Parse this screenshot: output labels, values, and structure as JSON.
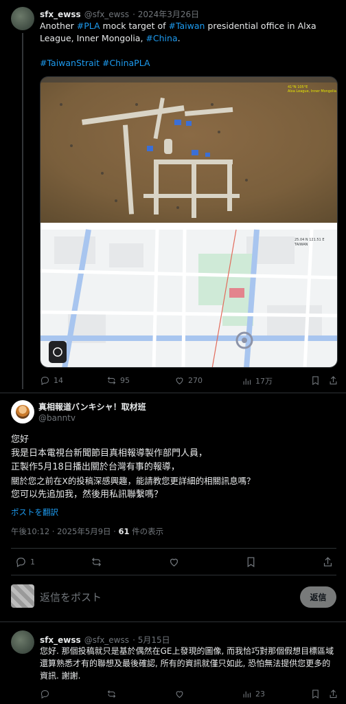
{
  "tweet1": {
    "name": "sfx_ewss",
    "handle": "@sfx_ewss",
    "date": "· 2024年3月26日",
    "text_parts": [
      "Another ",
      "#PLA",
      " mock target of ",
      "#Taiwan",
      " presidential office in Alxa League, Inner Mongolia, ",
      "#China",
      "."
    ],
    "hashtags_line": [
      "#TaiwanStrait",
      "#ChinaPLA"
    ],
    "map_label": "TAIWAN",
    "actions": {
      "replies": "14",
      "reposts": "95",
      "likes": "270",
      "views": "17万"
    }
  },
  "tweet2": {
    "name": "真相報道バンキシャ！取材班",
    "handle": "@banntv",
    "lines": [
      "您好",
      "我是日本電視台新聞節目真相報導製作部門人員，",
      "正製作5月18日播出關於台灣有事的報導，",
      "關於您之前在X的投稿深感興趣，能請教您更詳細的相關訊息嗎？",
      "您可以先追加我，然後用私訊聯繫嗎？"
    ],
    "translate": "ポストを翻訳",
    "meta_time": "午後10:12 · 2025年5月9日 · ",
    "meta_views": "61",
    "meta_suffix": " 件の表示",
    "actions": {
      "replies": "1"
    }
  },
  "reply_box": {
    "placeholder": "返信をポスト",
    "button": "返信"
  },
  "tweet3": {
    "name": "sfx_ewss",
    "handle": "@sfx_ewss",
    "date": "· 5月15日",
    "text": "您好. 那個投稿就只是基於偶然在GE上發現的圖像, 而我恰巧對那個假想目標區域還算熟悉才有的聯想及最後確認, 所有的資訊就僅只如此, 恐怕無法提供您更多的資訊. 謝謝.",
    "views": "23"
  },
  "colors": {
    "accent": "#1d9bf0",
    "background": "#000000",
    "divider": "#2f3336"
  }
}
